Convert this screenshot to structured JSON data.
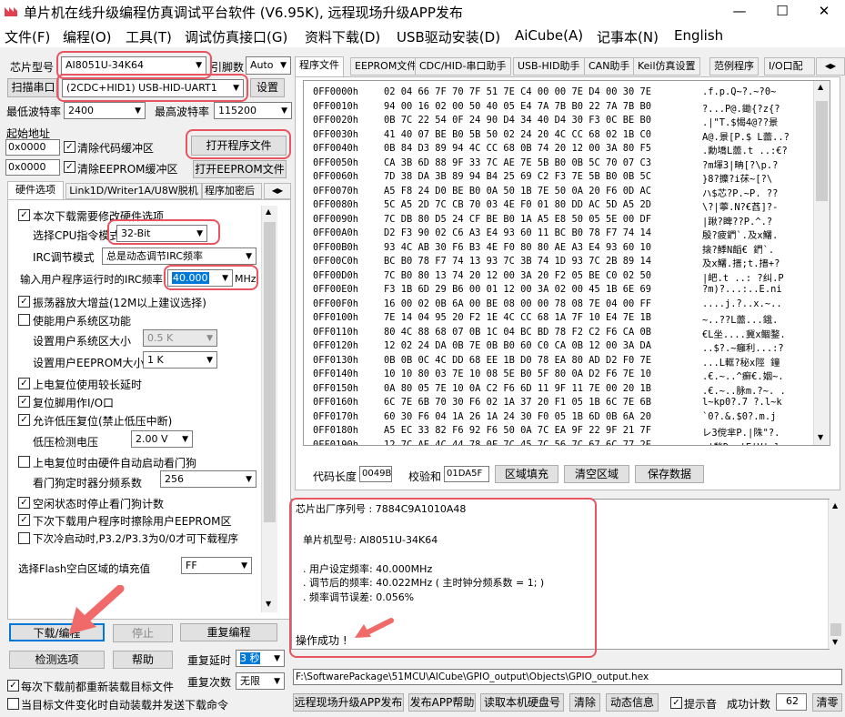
{
  "titlebar": {
    "title": "单片机在线升级编程仿真调试平台软件 (V6.95K), 远程现场升级APP发布",
    "minimize": "—",
    "maximize": "☐",
    "close": "✕"
  },
  "menu": [
    "文件(F)",
    "编程(O)",
    "工具(T)",
    "调试仿真接口(G)",
    "资料下载(D)",
    "USB驱动安装(D)",
    "AiCube(A)",
    "记事本(N)",
    "English"
  ],
  "left": {
    "chip_label": "芯片型号",
    "chip_value": "AI8051U-34K64",
    "pins_label": "引脚数",
    "pins_value": "Auto",
    "scan_button": "扫描串口",
    "port_value": "(2CDC+HID1) USB-HID-UART1",
    "settings_button": "设置",
    "min_baud_label": "最低波特率",
    "min_baud_value": "2400",
    "max_baud_label": "最高波特率",
    "max_baud_value": "115200",
    "start_addr_label": "起始地址",
    "addr1": "0x0000",
    "clear_code": "清除代码缓冲区",
    "addr2": "0x0000",
    "clear_eeprom": "清除EEPROM缓冲区",
    "open_program": "打开程序文件",
    "open_eeprom": "打开EEPROM文件",
    "tabs": [
      "硬件选项",
      "Link1D/Writer1A/U8W脱机",
      "程序加密后"
    ],
    "hw": {
      "opt_reinstall": "本次下载需要修改硬件选项",
      "cpu_mode_label": "选择CPU指令模式",
      "cpu_mode_value": "32-Bit",
      "irc_mode_label": "IRC调节模式",
      "irc_mode_value": "总是动态调节IRC频率",
      "irc_freq_label": "输入用户程序运行时的IRC频率",
      "irc_freq_value": "40.000",
      "irc_unit": "MHz",
      "osc_gain": "振荡器放大增益(12M以上建议选择)",
      "user_sys_area": "使能用户系统区功能",
      "sys_size_label": "设置用户系统区大小",
      "sys_size_value": "0.5 K",
      "eeprom_size_label": "设置用户EEPROM大小",
      "eeprom_size_value": "1   K",
      "long_reset": "上电复位使用较长延时",
      "reset_pin": "复位脚用作I/O口",
      "lvd_reset": "允许低压复位(禁止低压中断)",
      "lvd_label": "低压检测电压",
      "lvd_value": "2.00 V",
      "wdt_auto": "上电复位时由硬件自动启动看门狗",
      "wdt_div_label": "看门狗定时器分频系数",
      "wdt_div_value": "256",
      "idle_stop_wdt": "空闲状态时停止看门狗计数",
      "erase_eeprom": "下次下载用户程序时擦除用户EEPROM区",
      "cold_boot": "下次冷启动时,P3.2/P3.3为0/0才可下载程序",
      "fill_label": "选择Flash空白区域的填充值",
      "fill_value": "FF"
    },
    "download_button": "下载/编程",
    "stop_button": "停止",
    "redownload_button": "重复编程",
    "check_button": "检测选项",
    "help_button": "帮助",
    "repeat_delay_label": "重复延时",
    "repeat_delay_value": "3 秒",
    "repeat_count_label": "重复次数",
    "repeat_count_value": "无限",
    "reload_each": "每次下载前都重新装载目标文件",
    "auto_on_change": "当目标文件变化时自动装载并发送下载命令"
  },
  "right": {
    "tabs": [
      "程序文件",
      "EEPROM文件",
      "CDC/HID-串口助手",
      "USB-HID助手",
      "CAN助手",
      "Keil仿真设置",
      "范例程序",
      "I/O口配"
    ],
    "hex_rows": [
      {
        "addr": "0FF0000h",
        "bytes": "02 04 66 7F 70 7F 51 7E C4 00 00 7E D4 00 30 7E",
        "ascii": ".f.p.Q~?.~?0~"
      },
      {
        "addr": "0FF0010h",
        "bytes": "94 00 16 02 00 50 40 05 E4 7A 7B B0 22 7A 7B B0",
        "ascii": "?...P@.鋤{?z{?"
      },
      {
        "addr": "0FF0020h",
        "bytes": "0B 7C 22 54 0F 24 90 D4 34 40 D4 30 F3 0C BE B0",
        "ascii": ".|\"T.$愒4@??景"
      },
      {
        "addr": "0FF0030h",
        "bytes": "41 40 07 BE B0 5B 50 02 24 20 4C CC 68 02 1B C0",
        "ascii": "A@.景[P.$ L蘦..?"
      },
      {
        "addr": "0FF0040h",
        "bytes": "0B 84 D3 89 94 4C CC 68 0B 74 20 12 00 3A 80 F5",
        "ascii": ".勳墧L蘦.t ..:€?"
      },
      {
        "addr": "0FF0050h",
        "CA": "",
        "bytes": "CA 3B 6D 88 9F 33 7C AE 7E 5B B0 0B 5C 70 07 C3",
        "ascii": "?m堚3|畘[?\\p.?"
      },
      {
        "addr": "0FF0060h",
        "bytes": "7D 38 DA 3B 89 94 B4 25 69 C2 F3 7E 5B B0 0B 5C",
        "ascii": "}8?攗?i茠~[?\\"
      },
      {
        "addr": "0FF0070h",
        "bytes": "A5 F8 24 D0 BE B0 0A 50 1B 7E 50 0A 20 F6 0D AC",
        "ascii": "ハ$芯?P.~P. ??"
      },
      {
        "addr": "0FF0080h",
        "bytes": "5C A5 2D 7C CB 70 03 4E F0 01 80 DD AC 5D A5 2D",
        "ascii": "\\?|薴.N?€萏]?-"
      },
      {
        "addr": "0FF0090h",
        "bytes": "7C DB 80 D5 24 CF BE B0 1A A5 E8 50 05 5E 00 DF",
        "ascii": "|踿?睥??P.^.?"
      },
      {
        "addr": "0FF00A0h",
        "bytes": "D2 F3 90 02 C6 A3 E4 93 60 11 BC B0 78 F7 74 14",
        "ascii": "殷?疲鍆`.及x鱰."
      },
      {
        "addr": "0FF00B0h",
        "bytes": "93 4C AB 30 F6 B3 4E F0 80 80 AE A3 E4 93 60 10",
        "ascii": "搇?鯚N饀€ 鍆`."
      },
      {
        "addr": "0FF00C0h",
        "bytes": "BC B0 78 F7 74 13 93 7C 3B 74 1D 93 7C 2B 89 14",
        "ascii": "及x鱰.搢;t.搢+?"
      },
      {
        "addr": "0FF00D0h",
        "bytes": "7C B0 80 13 74 20 12 00 3A 20 F2 05 BE C0 02 50",
        "ascii": "|皅.t ..: ?纠.P"
      },
      {
        "addr": "0FF00E0h",
        "bytes": "F3 1B 6D 29 B6 00 01 12 00 3A 02 00 45 1B 6E 69",
        "ascii": "?m)?...:..E.ni"
      },
      {
        "addr": "0FF00F0h",
        "bytes": "16 00 02 0B 6A 00 BE 08 00 00 78 08 7E 04 00 FF",
        "ascii": "....j.?..x.~.."
      },
      {
        "addr": "0FF0100h",
        "bytes": "7E 14 04 95 20 F2 1E 4C CC 68 1A 7F 10 E4 7E 1B",
        "ascii": "~..??L蘦...鋨."
      },
      {
        "addr": "0FF0110h",
        "bytes": "80 4C 88 68 07 0B 1C 04 BC BD 78 F2 C2 F6 CA 0B",
        "ascii": "€L坐....冀x鲴鍪."
      },
      {
        "addr": "0FF0120h",
        "bytes": "12 02 24 DA 0B 7E 0B B0 60 C0 CA 0B 12 00 3A DA",
        "ascii": "..$?.~癰利...:?"
      },
      {
        "addr": "0FF0130h",
        "bytes": "0B 0B 0C 4C DD 68 EE 1B D0 78 EA 80 AD D2 F0 7E",
        "ascii": "...L軭?秘x陘 鐘"
      },
      {
        "addr": "0FF0140h",
        "bytes": "10 10 80 03 7E 10 08 5E B0 5F 80 0A D2 F6 7E 10",
        "ascii": ".€.~..^癬€.姻~."
      },
      {
        "addr": "0FF0150h",
        "bytes": "0A 80 05 7E 10 0A C2 F6 6D 11 9F 11 7E 00 20 1B",
        "ascii": ".€.~..脉m.?~. ."
      },
      {
        "addr": "0FF0160h",
        "bytes": "6C 7E 6B 70 30 F6 02 1A 37 20 F1 05 1B 6C 7E 6B",
        "ascii": "l~kp0?.7 ?.l~k"
      },
      {
        "addr": "0FF0170h",
        "bytes": "60 30 F6 04 1A 26 1A 24 30 F0 05 1B 6D 0B 6A 20",
        "ascii": "`0?.&.$0?.m.j "
      },
      {
        "addr": "0FF0180h",
        "bytes": "A5 EC 33 82 F6 92 F6 50 0A 7C EA 9F 22 9F 21 7F",
        "ascii": "レ3傥芈P.|陎\"?."
      },
      {
        "addr": "0FF0190h",
        "bytes": "12 7C AE 4C 44 78 0F 7C 45 7C 56 7C 67 6C 77 2E",
        "ascii": ".|甃Dx.|E|V|glw."
      }
    ],
    "code_len_label": "代码长度",
    "code_len_value": "0049B",
    "checksum_label": "校验和",
    "checksum_value": "01DA5F",
    "fill_area_button": "区域填充",
    "clear_area_button": "清空区域",
    "save_data_button": "保存数据",
    "log": {
      "line0": "芯片出厂序列号 : 7884C9A1010A48",
      "line1": "单片机型号: AI8051U-34K64",
      "line2": ". 用户设定频率: 40.000MHz",
      "line3": ". 调节后的频率: 40.022MHz ( 主时钟分频系数 = 1; )",
      "line4": ". 频率调节误差: 0.056%",
      "line5": "操作成功 !"
    },
    "file_path": "F:\\SoftwarePackage\\51MCU\\AICube\\GPIO_output\\Objects\\GPIO_output.hex",
    "remote_publish": "远程现场升级APP发布",
    "publish_help": "发布APP帮助",
    "read_disk": "读取本机硬盘号",
    "clear_button": "清除",
    "dynamic_info": "动态信息",
    "beep_label": "提示音",
    "success_label": "成功计数",
    "success_value": "62",
    "clear_count": "清零"
  },
  "colors": {
    "highlight_red": "#e85560",
    "arrow_red": "#f06a6a"
  }
}
